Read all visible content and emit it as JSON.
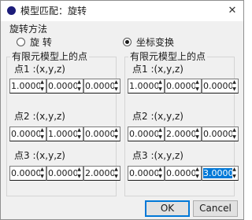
{
  "window": {
    "title": "模型匹配：旋转",
    "close_glyph": "✕"
  },
  "method_group": {
    "title": "旋转方法",
    "options": [
      {
        "label": "旋  转",
        "checked": false
      },
      {
        "label": "坐标变换",
        "checked": true
      }
    ]
  },
  "panels": [
    {
      "title": "有限元模型上的点",
      "points": [
        {
          "label": "点1 :(x,y,z)",
          "values": [
            "1.0000",
            "0.0000",
            "0.0000"
          ]
        },
        {
          "label": "点2 :(x,y,z)",
          "values": [
            "0.0000",
            "1.0000",
            "0.0000"
          ]
        },
        {
          "label": "点3 :(x,y,z)",
          "values": [
            "0.0000",
            "0.0000",
            "2.0000"
          ]
        }
      ]
    },
    {
      "title": "有限元模型上的点",
      "points": [
        {
          "label": "点1 :(x,y,z)",
          "values": [
            "1.0000",
            "0.0000",
            "0.0000"
          ]
        },
        {
          "label": "点2 :(x,y,z)",
          "values": [
            "0.0000",
            "2.0000",
            "0.0000"
          ]
        },
        {
          "label": "点3 :(x,y,z)",
          "values": [
            "0.0000",
            "0.0000",
            "3.0000"
          ]
        }
      ]
    }
  ],
  "selected_field": "panels.1.points.2.values.2",
  "buttons": {
    "ok": "OK",
    "cancel": "Cancel"
  }
}
